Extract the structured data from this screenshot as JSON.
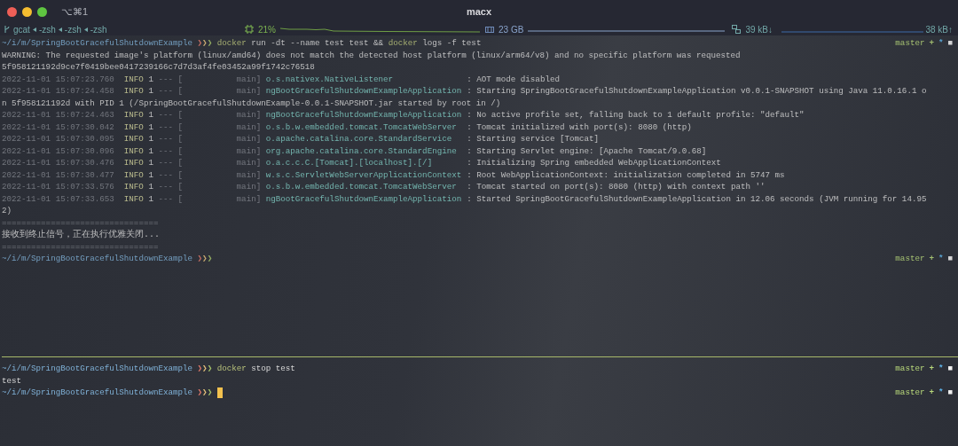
{
  "window": {
    "title": "macx",
    "shortcut": "⌥⌘1"
  },
  "status_bar": {
    "jobs": [
      "gcat",
      "-zsh",
      "-zsh",
      "-zsh"
    ],
    "cpu": "21%",
    "memory": "23 GB",
    "net_down": "39 kB↓",
    "net_up": "38 kB↑"
  },
  "panes": [
    {
      "active": false,
      "lines": [
        {
          "kind": "prompt",
          "path": "~/i/m/SpringBootGracefulShutdownExample",
          "symbol": "❯❯❯",
          "command": [
            {
              "text": "docker",
              "kind": "program"
            },
            {
              "text": "run -dt --name test test &&",
              "kind": "arg"
            },
            {
              "text": "docker",
              "kind": "program"
            },
            {
              "text": "logs -f test",
              "kind": "arg"
            }
          ],
          "git": {
            "branch": "master",
            "staged": "+",
            "modified": "*",
            "untracked": "■"
          },
          "cursor": false
        },
        {
          "kind": "text",
          "text": "WARNING: The requested image's platform (linux/amd64) does not match the detected host platform (linux/arm64/v8) and no specific platform was requested"
        },
        {
          "kind": "text",
          "text": "5f958121192d9ce7f0419bee0417239166c7d7d3af4fe03452a99f1742c76518"
        },
        {
          "kind": "log",
          "time": "2022-11-01 15:07:23.760",
          "level": "INFO",
          "pid": "1",
          "thread": "--- [           main]",
          "logger": "o.s.nativex.NativeListener",
          "sep": ":",
          "message": "AOT mode disabled"
        },
        {
          "kind": "log",
          "time": "2022-11-01 15:07:24.458",
          "level": "INFO",
          "pid": "1",
          "thread": "--- [           main]",
          "logger": "ngBootGracefulShutdownExampleApplication",
          "sep": ":",
          "message": "Starting SpringBootGracefulShutdownExampleApplication v0.0.1-SNAPSHOT using Java 11.0.16.1 o"
        },
        {
          "kind": "text",
          "text": "n 5f958121192d with PID 1 (/SpringBootGracefulShutdownExample-0.0.1-SNAPSHOT.jar started by root in /)"
        },
        {
          "kind": "log",
          "time": "2022-11-01 15:07:24.463",
          "level": "INFO",
          "pid": "1",
          "thread": "--- [           main]",
          "logger": "ngBootGracefulShutdownExampleApplication",
          "sep": ":",
          "message": "No active profile set, falling back to 1 default profile: \"default\""
        },
        {
          "kind": "log",
          "time": "2022-11-01 15:07:30.042",
          "level": "INFO",
          "pid": "1",
          "thread": "--- [           main]",
          "logger": "o.s.b.w.embedded.tomcat.TomcatWebServer",
          "sep": ":",
          "message": "Tomcat initialized with port(s): 8080 (http)"
        },
        {
          "kind": "log",
          "time": "2022-11-01 15:07:30.095",
          "level": "INFO",
          "pid": "1",
          "thread": "--- [           main]",
          "logger": "o.apache.catalina.core.StandardService",
          "sep": ":",
          "message": "Starting service [Tomcat]"
        },
        {
          "kind": "log",
          "time": "2022-11-01 15:07:30.096",
          "level": "INFO",
          "pid": "1",
          "thread": "--- [           main]",
          "logger": "org.apache.catalina.core.StandardEngine",
          "sep": ":",
          "message": "Starting Servlet engine: [Apache Tomcat/9.0.68]"
        },
        {
          "kind": "log",
          "time": "2022-11-01 15:07:30.476",
          "level": "INFO",
          "pid": "1",
          "thread": "--- [           main]",
          "logger": "o.a.c.c.C.[Tomcat].[localhost].[/]",
          "sep": ":",
          "message": "Initializing Spring embedded WebApplicationContext"
        },
        {
          "kind": "log",
          "time": "2022-11-01 15:07:30.477",
          "level": "INFO",
          "pid": "1",
          "thread": "--- [           main]",
          "logger": "w.s.c.ServletWebServerApplicationContext",
          "sep": ":",
          "message": "Root WebApplicationContext: initialization completed in 5747 ms"
        },
        {
          "kind": "log",
          "time": "2022-11-01 15:07:33.576",
          "level": "INFO",
          "pid": "1",
          "thread": "--- [           main]",
          "logger": "o.s.b.w.embedded.tomcat.TomcatWebServer",
          "sep": ":",
          "message": "Tomcat started on port(s): 8080 (http) with context path ''"
        },
        {
          "kind": "log",
          "time": "2022-11-01 15:07:33.653",
          "level": "INFO",
          "pid": "1",
          "thread": "--- [           main]",
          "logger": "ngBootGracefulShutdownExampleApplication",
          "sep": ":",
          "message": "Started SpringBootGracefulShutdownExampleApplication in 12.06 seconds (JVM running for 14.95"
        },
        {
          "kind": "text",
          "text": "2)"
        },
        {
          "kind": "rule",
          "text": "================================"
        },
        {
          "kind": "notice",
          "text": "接收到终止信号，正在执行优雅关闭..."
        },
        {
          "kind": "rule",
          "text": "================================"
        },
        {
          "kind": "prompt",
          "path": "~/i/m/SpringBootGracefulShutdownExample",
          "symbol": "❯❯❯",
          "git": {
            "branch": "master",
            "staged": "+",
            "modified": "*",
            "untracked": "■"
          },
          "cursor": false
        }
      ]
    },
    {
      "active": true,
      "lines": [
        {
          "kind": "prompt",
          "path": "~/i/m/SpringBootGracefulShutdownExample",
          "symbol": "❯❯❯",
          "command": [
            {
              "text": "docker",
              "kind": "program"
            },
            {
              "text": "stop test",
              "kind": "arg"
            }
          ],
          "git": {
            "branch": "master",
            "staged": "+",
            "modified": "*",
            "untracked": "■"
          },
          "cursor": false
        },
        {
          "kind": "text",
          "text": "test"
        },
        {
          "kind": "prompt",
          "path": "~/i/m/SpringBootGracefulShutdownExample",
          "symbol": "❯❯❯",
          "git": {
            "branch": "master",
            "staged": "+",
            "modified": "*",
            "untracked": "■"
          },
          "cursor": true
        }
      ]
    }
  ]
}
